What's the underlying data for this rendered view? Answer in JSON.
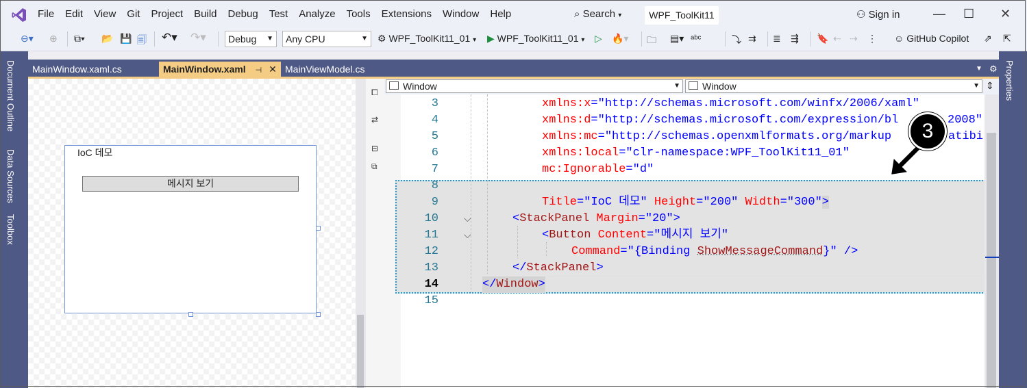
{
  "titlebar": {
    "menu": [
      "File",
      "Edit",
      "View",
      "Git",
      "Project",
      "Build",
      "Debug",
      "Test",
      "Analyze",
      "Tools",
      "Extensions",
      "Window",
      "Help"
    ],
    "search_label": "Search",
    "solution_name": "WPF_ToolKit11",
    "signin_label": "Sign in"
  },
  "toolbar": {
    "config": "Debug",
    "platform": "Any CPU",
    "startup_project": "WPF_ToolKit11_01",
    "run_target": "WPF_ToolKit11_01",
    "copilot_label": "GitHub Copilot"
  },
  "side_tabs": [
    "Document Outline",
    "Data Sources",
    "Toolbox"
  ],
  "right_tabs": [
    "Properties"
  ],
  "doc_tabs": [
    {
      "label": "MainWindow.xaml.cs",
      "active": false
    },
    {
      "label": "MainWindow.xaml",
      "active": true
    },
    {
      "label": "MainViewModel.cs",
      "active": false
    }
  ],
  "designer": {
    "window_title": "IoC 데모",
    "button_content": "메시지 보기"
  },
  "editor": {
    "left_combo": "Window",
    "right_combo": "Window",
    "lines": [
      {
        "n": "3"
      },
      {
        "n": "4"
      },
      {
        "n": "5"
      },
      {
        "n": "6"
      },
      {
        "n": "7"
      },
      {
        "n": "8"
      },
      {
        "n": "9"
      },
      {
        "n": "10"
      },
      {
        "n": "11"
      },
      {
        "n": "12"
      },
      {
        "n": "13"
      },
      {
        "n": "14"
      },
      {
        "n": "15"
      }
    ],
    "code": {
      "l3a": "xmlns",
      "l3b": ":x",
      "l3c": "=\"http://schemas.microsoft.com/winfx/2006/xaml\"",
      "l4a": "xmlns",
      "l4b": ":d",
      "l4c": "=\"http://schemas.microsoft.com/expression/bl",
      "l4d": "2008\"",
      "l5a": "xmlns",
      "l5b": ":mc",
      "l5c": "=\"http://schemas.openxmlformats.org/markup",
      "l5d": "atibi",
      "l6a": "xmlns",
      "l6b": ":local",
      "l6c": "=\"clr-namespace:WPF_ToolKit11_01\"",
      "l7a": "mc:Ignorable",
      "l7c": "=\"d\"",
      "l9a": "Title",
      "l9b": "=\"IoC 데모\"",
      "l9c": " Height",
      "l9d": "=\"200\"",
      "l9e": " Width",
      "l9f": "=\"300\"",
      "l9g": ">",
      "l10a": "<",
      "l10b": "StackPanel",
      "l10c": " Margin",
      "l10d": "=\"20\"",
      "l10e": ">",
      "l11a": "<",
      "l11b": "Button",
      "l11c": " Content",
      "l11d": "=\"메시지 보기\"",
      "l12a": "Command",
      "l12b": "=\"{Binding ",
      "l12c": "ShowMessageCommand",
      "l12d": "}\"",
      "l12e": " />",
      "l13a": "</",
      "l13b": "StackPanel",
      "l13c": ">",
      "l14a": "</",
      "l14b": "Window",
      "l14c": ">"
    }
  },
  "annotation": {
    "step": "3"
  },
  "colors": {
    "accent": "#F5CC84",
    "panel": "#4E5986",
    "highlight_border": "#1E9BD6"
  }
}
